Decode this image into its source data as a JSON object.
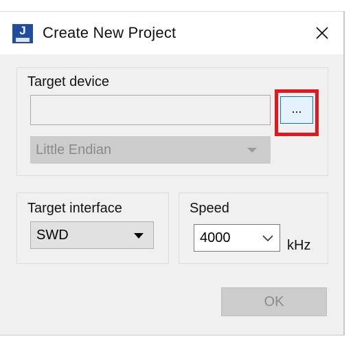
{
  "window": {
    "title": "Create New Project",
    "icon_letter": "J",
    "icon": "jlink-app-icon",
    "close_icon": "close-icon"
  },
  "target_device": {
    "group_label": "Target device",
    "device_value": "",
    "browse_label": "...",
    "endianness": "Little Endian"
  },
  "target_interface": {
    "group_label": "Target interface",
    "selected": "SWD"
  },
  "speed": {
    "group_label": "Speed",
    "selected": "4000",
    "unit": "kHz"
  },
  "actions": {
    "ok_label": "OK"
  },
  "colors": {
    "highlight": "#e3161b",
    "browse_border": "#0078d7",
    "icon_blue": "#1f4e9e"
  }
}
